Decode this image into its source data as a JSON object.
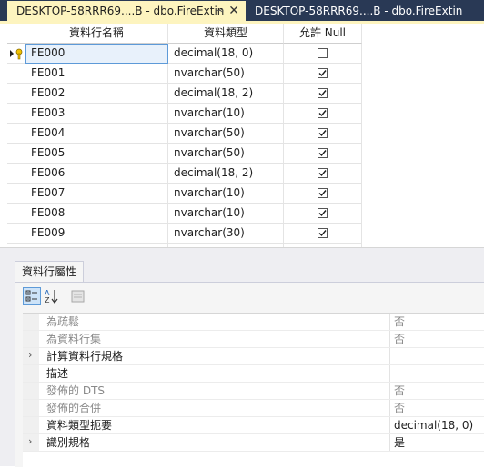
{
  "tabs": [
    {
      "label": "DESKTOP-58RRR69....B - dbo.FireExtin",
      "active": true,
      "pin": "⊸",
      "close": "✕"
    },
    {
      "label": "DESKTOP-58RRR69....B - dbo.FireExtin",
      "active": false
    }
  ],
  "grid": {
    "columns": [
      "資料行名稱",
      "資料類型",
      "允許 Null"
    ],
    "rows": [
      {
        "name": "FE000",
        "type": "decimal(18, 0)",
        "allow_null": false,
        "selected": true
      },
      {
        "name": "FE001",
        "type": "nvarchar(50)",
        "allow_null": true
      },
      {
        "name": "FE002",
        "type": "decimal(18, 2)",
        "allow_null": true
      },
      {
        "name": "FE003",
        "type": "nvarchar(10)",
        "allow_null": true
      },
      {
        "name": "FE004",
        "type": "nvarchar(50)",
        "allow_null": true
      },
      {
        "name": "FE005",
        "type": "nvarchar(50)",
        "allow_null": true
      },
      {
        "name": "FE006",
        "type": "decimal(18, 2)",
        "allow_null": true
      },
      {
        "name": "FE007",
        "type": "nvarchar(10)",
        "allow_null": true
      },
      {
        "name": "FE008",
        "type": "nvarchar(10)",
        "allow_null": true
      },
      {
        "name": "FE009",
        "type": "nvarchar(30)",
        "allow_null": true
      }
    ]
  },
  "properties": {
    "tab_label": "資料行屬性",
    "toolbar": [
      "categorized-icon",
      "alphabetical-sort-icon",
      "property-pages-icon"
    ],
    "rows": [
      {
        "name": "為疏鬆",
        "value": "否",
        "dim": true,
        "expandable": false
      },
      {
        "name": "為資料行集",
        "value": "否",
        "dim": true,
        "expandable": false
      },
      {
        "name": "計算資料行規格",
        "value": "",
        "dim": false,
        "expandable": true
      },
      {
        "name": "描述",
        "value": "",
        "dim": false,
        "expandable": false
      },
      {
        "name": "發佈的 DTS",
        "value": "否",
        "dim": true,
        "expandable": false
      },
      {
        "name": "發佈的合併",
        "value": "否",
        "dim": true,
        "expandable": false
      },
      {
        "name": "資料類型扼要",
        "value": "decimal(18, 0)",
        "dim": false,
        "expandable": false
      },
      {
        "name": "識別規格",
        "value": "是",
        "dim": false,
        "expandable": true
      }
    ]
  }
}
